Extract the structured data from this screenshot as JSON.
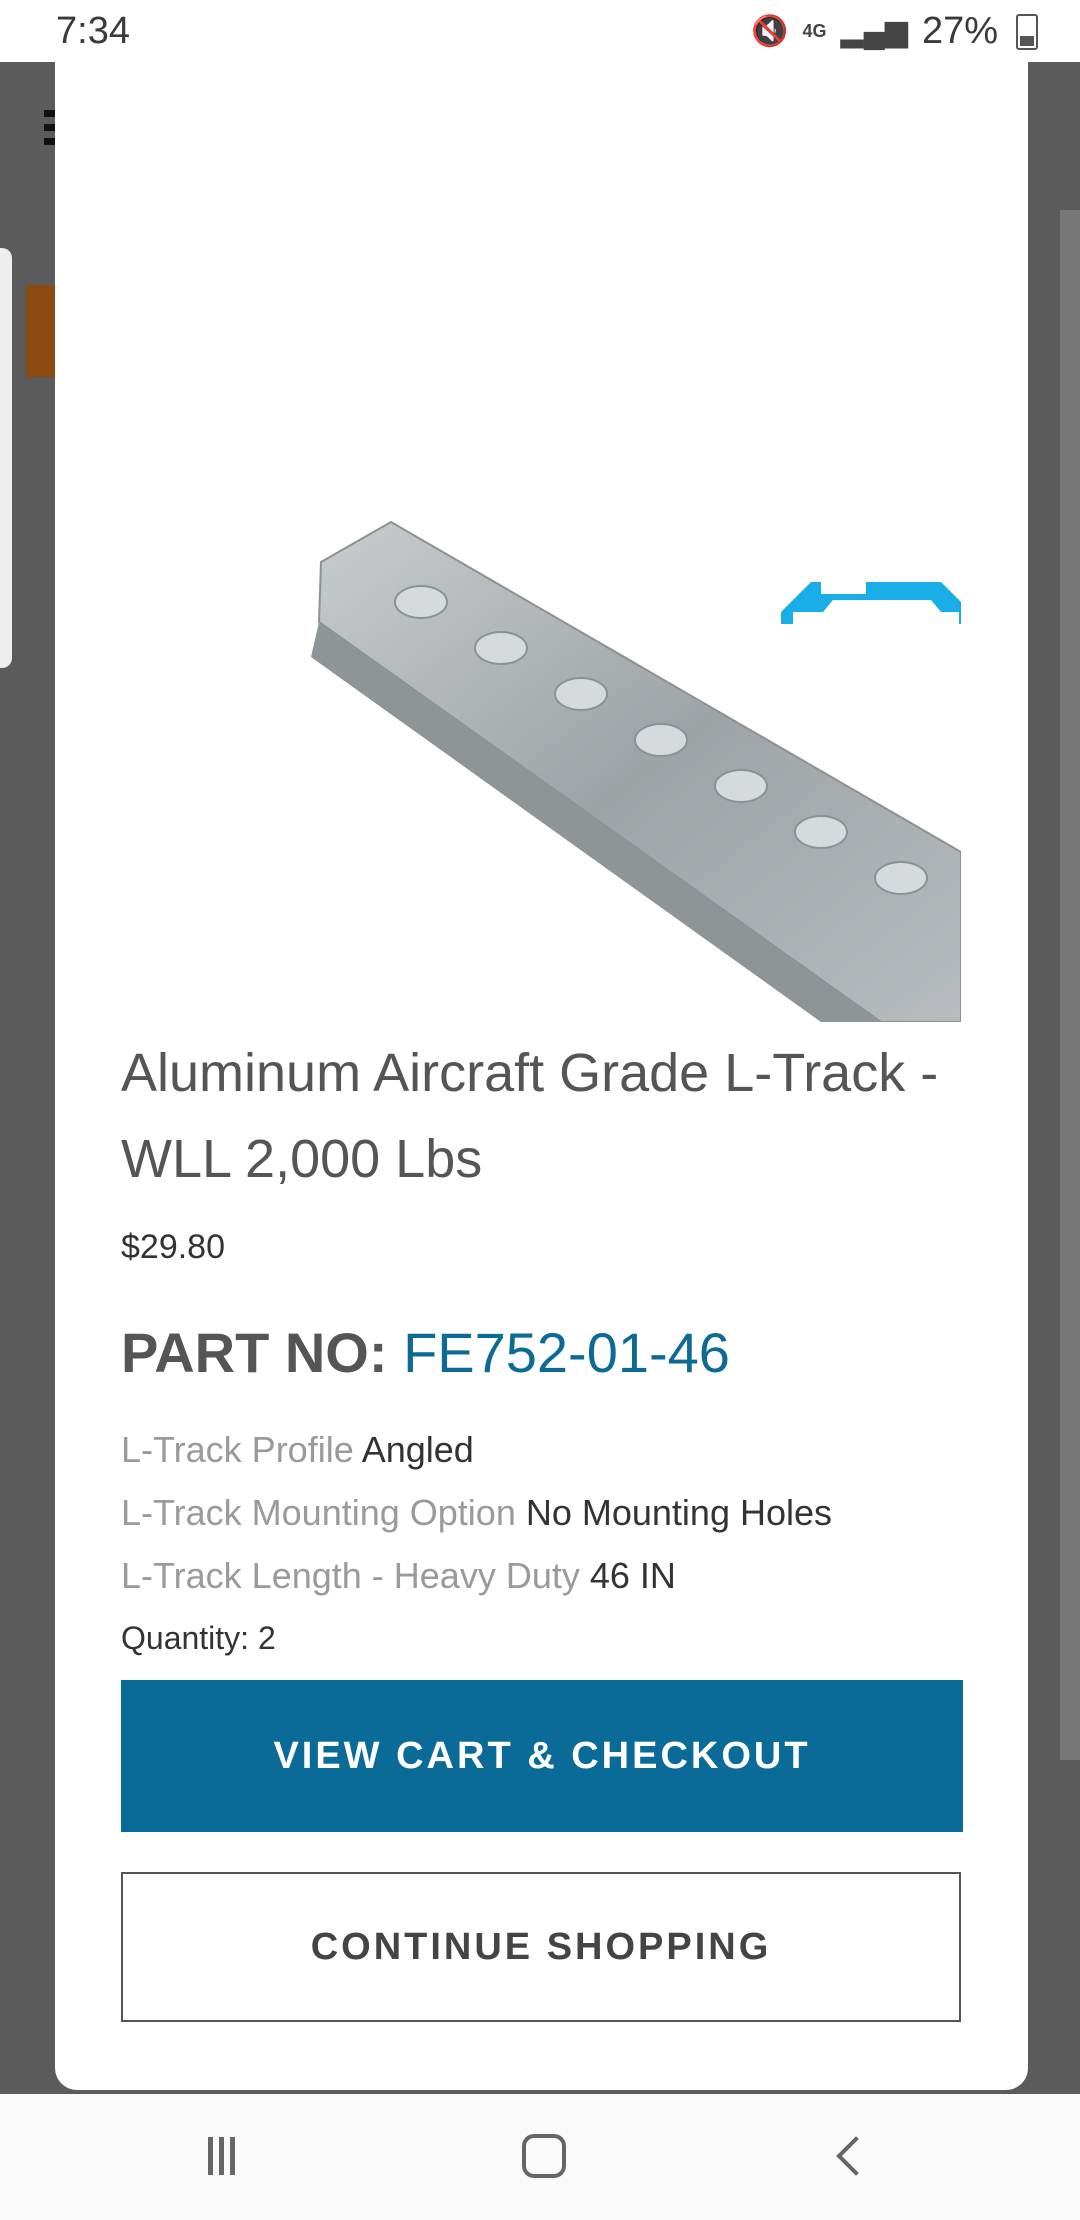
{
  "status_bar": {
    "time": "7:34",
    "network": "4G",
    "battery": "27%"
  },
  "modal": {
    "product_title": "Aluminum Aircraft Grade L-Track - WLL 2,000 Lbs",
    "price": "$29.80",
    "part_no_label": "PART NO:",
    "part_no_value": "FE752-01-46",
    "options": [
      {
        "key": "L-Track Profile",
        "value": "Angled"
      },
      {
        "key": "L-Track Mounting Option",
        "value": "No Mounting Holes"
      },
      {
        "key": "L-Track Length - Heavy Duty",
        "value": "46 IN"
      }
    ],
    "quantity_label": "Quantity:",
    "quantity_value": "2",
    "checkout_label": "VIEW CART & CHECKOUT",
    "continue_label": "CONTINUE SHOPPING"
  },
  "colors": {
    "accent": "#0a6b98",
    "part_no": "#0d6a94",
    "profile_icon": "#1aaee8"
  },
  "nav_bar": {
    "recent_icon": "recent-apps-icon",
    "home_icon": "home-icon",
    "back_icon": "back-icon"
  }
}
